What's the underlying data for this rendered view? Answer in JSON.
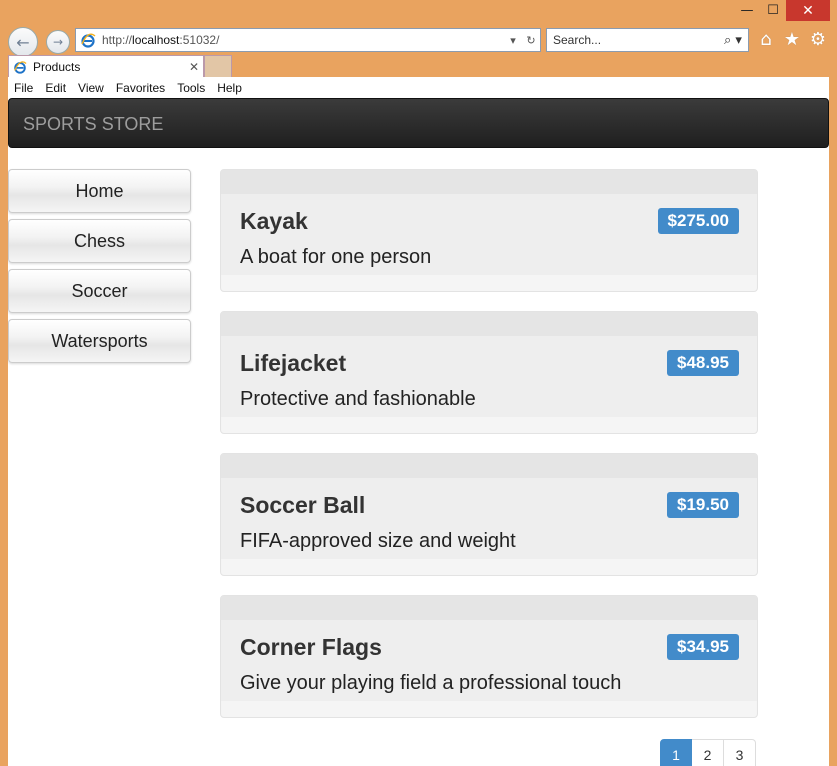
{
  "window": {
    "minimize": "—",
    "maximize": "☐",
    "close": "✕"
  },
  "nav": {
    "back_icon": "←",
    "forward_icon": "→",
    "url_prefix": "http://",
    "url_host": "localhost",
    "url_rest": ":51032/",
    "dropdown_icon": "▾",
    "refresh_icon": "↻",
    "search_placeholder": "Search...",
    "search_icon": "⌕ ▾",
    "home_icon": "⌂",
    "favorites_icon": "★",
    "tools_icon": "⚙"
  },
  "tab": {
    "title": "Products",
    "close_icon": "✕"
  },
  "menu": [
    "File",
    "Edit",
    "View",
    "Favorites",
    "Tools",
    "Help"
  ],
  "brand": "SPORTS STORE",
  "categories": [
    "Home",
    "Chess",
    "Soccer",
    "Watersports"
  ],
  "products": [
    {
      "name": "Kayak",
      "price": "$275.00",
      "description": "A boat for one person"
    },
    {
      "name": "Lifejacket",
      "price": "$48.95",
      "description": "Protective and fashionable"
    },
    {
      "name": "Soccer Ball",
      "price": "$19.50",
      "description": "FIFA-approved size and weight"
    },
    {
      "name": "Corner Flags",
      "price": "$34.95",
      "description": "Give your playing field a professional touch"
    }
  ],
  "pagination": {
    "pages": [
      "1",
      "2",
      "3"
    ],
    "current": "1"
  },
  "colors": {
    "accent": "#428bca",
    "frame": "#e9a35f",
    "navbar": "#222222",
    "close_button": "#c8372d"
  }
}
